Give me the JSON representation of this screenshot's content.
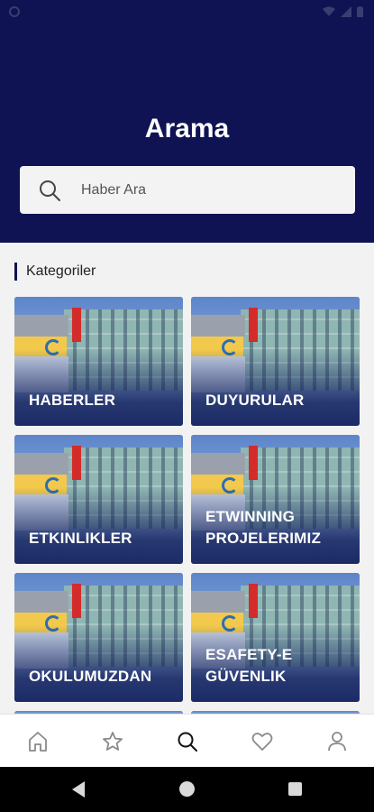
{
  "header": {
    "title": "Arama",
    "background_color": "#0f1353"
  },
  "search": {
    "placeholder": "Haber Ara",
    "icon": "search-icon"
  },
  "categories_section": {
    "label": "Kategoriler",
    "items": [
      {
        "label": "HABERLER"
      },
      {
        "label": "DUYURULAR"
      },
      {
        "label": "ETKINLIKLER"
      },
      {
        "label": "ETWINNING PROJELERIMIZ"
      },
      {
        "label": "OKULUMUZDAN"
      },
      {
        "label": "ESAFETY-EGÜVENLIK"
      }
    ]
  },
  "bottom_nav": {
    "items": [
      {
        "icon": "home-icon"
      },
      {
        "icon": "star-icon"
      },
      {
        "icon": "search-icon"
      },
      {
        "icon": "heart-icon"
      },
      {
        "icon": "profile-icon"
      }
    ]
  },
  "status_bar": {
    "icons": [
      "notification-icon",
      "wifi-icon",
      "signal-icon",
      "battery-icon"
    ]
  },
  "system_nav": {
    "icons": [
      "back-icon",
      "home-icon",
      "recents-icon"
    ]
  }
}
